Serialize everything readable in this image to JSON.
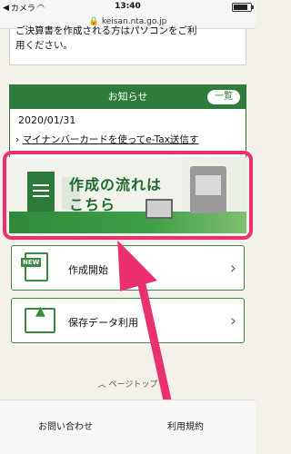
{
  "status": {
    "carrier": "カメラ",
    "time": "13:40"
  },
  "url": {
    "host": "keisan.nta.go.jp"
  },
  "top_card": {
    "line1": "ご決算書を作成される方はパソコンをご利",
    "line2": "用ください。"
  },
  "notice": {
    "title": "お知らせ",
    "list_button": "一覧",
    "date": "2020/01/31",
    "link": "マイナンバーカードを使ってe-Tax送信す"
  },
  "banner": {
    "line1": "作成の流れは",
    "line2": "こちら"
  },
  "menu": {
    "start_label": "作成開始",
    "saved_label": "保存データ利用",
    "new_tag": "NEW"
  },
  "page_top": "ページトップ",
  "footer": {
    "contact": "お問い合わせ",
    "terms": "利用規約"
  },
  "colors": {
    "brand_green": "#2e7c3c",
    "highlight_pink": "#ec2f6f"
  }
}
